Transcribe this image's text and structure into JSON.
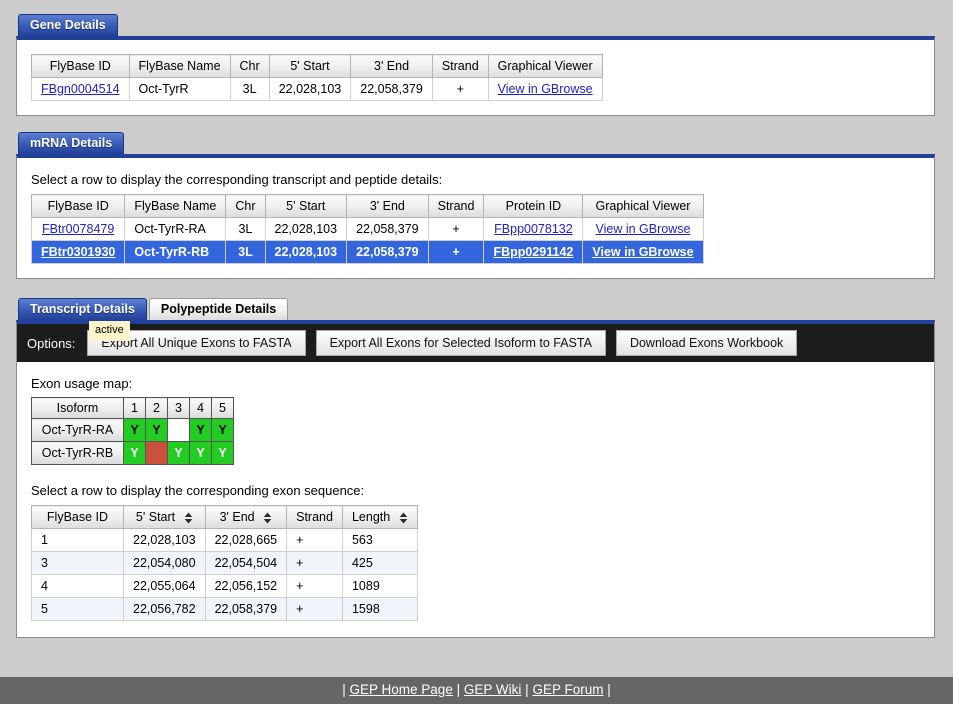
{
  "gene_panel": {
    "tab_label": "Gene Details",
    "table": {
      "headers": [
        "FlyBase ID",
        "FlyBase Name",
        "Chr",
        "5' Start",
        "3' End",
        "Strand",
        "Graphical Viewer"
      ],
      "rows": [
        {
          "flybase_id": "FBgn0004514",
          "flybase_name": "Oct-TyrR",
          "chr": "3L",
          "start": "22,028,103",
          "end": "22,058,379",
          "strand": "+",
          "viewer": "View in GBrowse"
        }
      ]
    }
  },
  "mrna_panel": {
    "tab_label": "mRNA Details",
    "prompt": "Select a row to display the corresponding transcript and peptide details:",
    "table": {
      "headers": [
        "FlyBase ID",
        "FlyBase Name",
        "Chr",
        "5' Start",
        "3' End",
        "Strand",
        "Protein ID",
        "Graphical Viewer"
      ],
      "rows": [
        {
          "flybase_id": "FBtr0078479",
          "flybase_name": "Oct-TyrR-RA",
          "chr": "3L",
          "start": "22,028,103",
          "end": "22,058,379",
          "strand": "+",
          "protein_id": "FBpp0078132",
          "viewer": "View in GBrowse",
          "selected": false
        },
        {
          "flybase_id": "FBtr0301930",
          "flybase_name": "Oct-TyrR-RB",
          "chr": "3L",
          "start": "22,028,103",
          "end": "22,058,379",
          "strand": "+",
          "protein_id": "FBpp0291142",
          "viewer": "View in GBrowse",
          "selected": true
        }
      ]
    }
  },
  "transcript_panel": {
    "tabs": [
      {
        "label": "Transcript Details",
        "active": true
      },
      {
        "label": "Polypeptide Details",
        "active": false
      }
    ],
    "toolbar": {
      "label": "Options:",
      "tooltip": "active",
      "buttons": [
        "Export All Unique Exons to FASTA",
        "Export All Exons for Selected Isoform to FASTA",
        "Download Exons Workbook"
      ]
    },
    "exon_map": {
      "title": "Exon usage map:",
      "isoform_header": "Isoform",
      "exon_numbers": [
        "1",
        "2",
        "3",
        "4",
        "5"
      ],
      "present_mark": "Y",
      "rows": [
        {
          "isoform": "Oct-TyrR-RA",
          "cells": [
            {
              "mark": "Y",
              "state": "present-dark"
            },
            {
              "mark": "Y",
              "state": "present-dark"
            },
            {
              "mark": "",
              "state": "absent-white"
            },
            {
              "mark": "Y",
              "state": "present-dark"
            },
            {
              "mark": "Y",
              "state": "present-dark"
            }
          ]
        },
        {
          "isoform": "Oct-TyrR-RB",
          "cells": [
            {
              "mark": "Y",
              "state": "present-light"
            },
            {
              "mark": "",
              "state": "absent-red"
            },
            {
              "mark": "Y",
              "state": "present-light"
            },
            {
              "mark": "Y",
              "state": "present-light"
            },
            {
              "mark": "Y",
              "state": "present-light"
            }
          ]
        }
      ]
    },
    "exon_table": {
      "prompt": "Select a row to display the corresponding exon sequence:",
      "headers": [
        {
          "label": "FlyBase ID",
          "sortable": false
        },
        {
          "label": "5' Start",
          "sortable": true
        },
        {
          "label": "3' End",
          "sortable": true
        },
        {
          "label": "Strand",
          "sortable": false
        },
        {
          "label": "Length",
          "sortable": true
        }
      ],
      "rows": [
        {
          "id": "1",
          "start": "22,028,103",
          "end": "22,028,665",
          "strand": "+",
          "length": "563"
        },
        {
          "id": "3",
          "start": "22,054,080",
          "end": "22,054,504",
          "strand": "+",
          "length": "425"
        },
        {
          "id": "4",
          "start": "22,055,064",
          "end": "22,056,152",
          "strand": "+",
          "length": "1089"
        },
        {
          "id": "5",
          "start": "22,056,782",
          "end": "22,058,379",
          "strand": "+",
          "length": "1598"
        }
      ]
    }
  },
  "footer": {
    "links": [
      "GEP Home Page",
      "GEP Wiki",
      "GEP Forum"
    ],
    "separator": "|"
  },
  "colors": {
    "tab_active": "#21409a",
    "row_selected": "#3366dd",
    "exon_present": "#22cc22",
    "exon_absent": "#c9513c",
    "toolbar_bg": "#1c1c1c",
    "footer_bg": "#666666",
    "tooltip_bg": "#fdf5c9",
    "link": "#2222cc"
  }
}
